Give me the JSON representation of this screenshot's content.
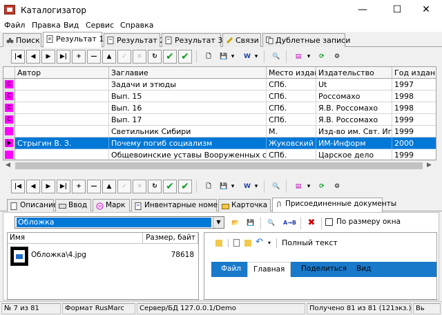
{
  "window": {
    "title": "Каталогизатор",
    "buttons": {
      "minimize": "—",
      "maximize": "☐",
      "close": "✕"
    }
  },
  "menu": [
    "Файл",
    "Правка",
    "Вид",
    "Сервис",
    "Справка"
  ],
  "main_tabs": [
    {
      "label": "Поиск",
      "active": false
    },
    {
      "label": "Результат 1",
      "active": true
    },
    {
      "label": "Результат 2",
      "active": false
    },
    {
      "label": "Результат 3",
      "active": false
    },
    {
      "label": "Связи",
      "active": false
    },
    {
      "label": "Дублетные записи",
      "active": false
    }
  ],
  "grid": {
    "columns": [
      "Автор",
      "Заглавие",
      "Место издания",
      "Издательство",
      "Год издани"
    ],
    "rows": [
      {
        "author": "",
        "title": "Задачи и этюды",
        "place": "СПб.",
        "publisher": "Ut",
        "year": "1997",
        "mark": "C",
        "selected": false
      },
      {
        "author": "",
        "title": "Вып. 15",
        "place": "СПб.",
        "publisher": "Россомахо",
        "year": "1998",
        "mark": "C",
        "selected": false
      },
      {
        "author": "",
        "title": "Вып. 16",
        "place": "СПб.",
        "publisher": "Я.В. Россомахо",
        "year": "1998",
        "mark": "C",
        "selected": false
      },
      {
        "author": "",
        "title": "Вып. 17",
        "place": "СПб.",
        "publisher": "Я.В. Россомахо",
        "year": "1999",
        "mark": "C",
        "selected": false
      },
      {
        "author": "",
        "title": "Светильник Сибири",
        "place": "М.",
        "publisher": "Изд-во им. Свт. Игнати",
        "year": "1999",
        "mark": "",
        "selected": false
      },
      {
        "author": "Стрыгин В. З.",
        "title": "Почему погиб социализм",
        "place": "Жуковский",
        "publisher": "ИМ-Информ",
        "year": "2000",
        "mark": "arrow",
        "selected": true
      },
      {
        "author": "",
        "title": "Общевоинские уставы Вооруженных сил Россий",
        "place": "СПб.",
        "publisher": "Царское дело",
        "year": "1999",
        "mark": "",
        "selected": false
      }
    ]
  },
  "detail_tabs": [
    {
      "label": "Описание",
      "active": false
    },
    {
      "label": "Ввод",
      "active": false
    },
    {
      "label": "Марк",
      "active": false
    },
    {
      "label": "Инвентарные номера",
      "active": false
    },
    {
      "label": "Карточка",
      "active": false
    },
    {
      "label": "Присоединенные документы",
      "active": true
    }
  ],
  "attachments": {
    "combo_value": "Обложка",
    "fit_label": "По размеру окна",
    "columns": {
      "name": "Имя",
      "size": "Размер, байт"
    },
    "files": [
      {
        "name": "Обложка\\4.jpg",
        "size": "78618"
      }
    ]
  },
  "preview": {
    "quick_title": "Полный текст",
    "ribbon_tabs": [
      "Файл",
      "Главная",
      "Поделиться",
      "Вид"
    ],
    "active_tab": "Главная"
  },
  "status": {
    "record": "№ 7 из 81",
    "format": "Формат RusMarc",
    "server": "Сервер/БД 127.0.0.1/Demo",
    "received": "Получено 81 из 81 (121экз.)",
    "extra": "Вь"
  },
  "colors": {
    "selection": "#0078d7",
    "mark": "#ff00ff",
    "check_green": "#0a9e20",
    "ribbon_blue": "#1979ca"
  }
}
